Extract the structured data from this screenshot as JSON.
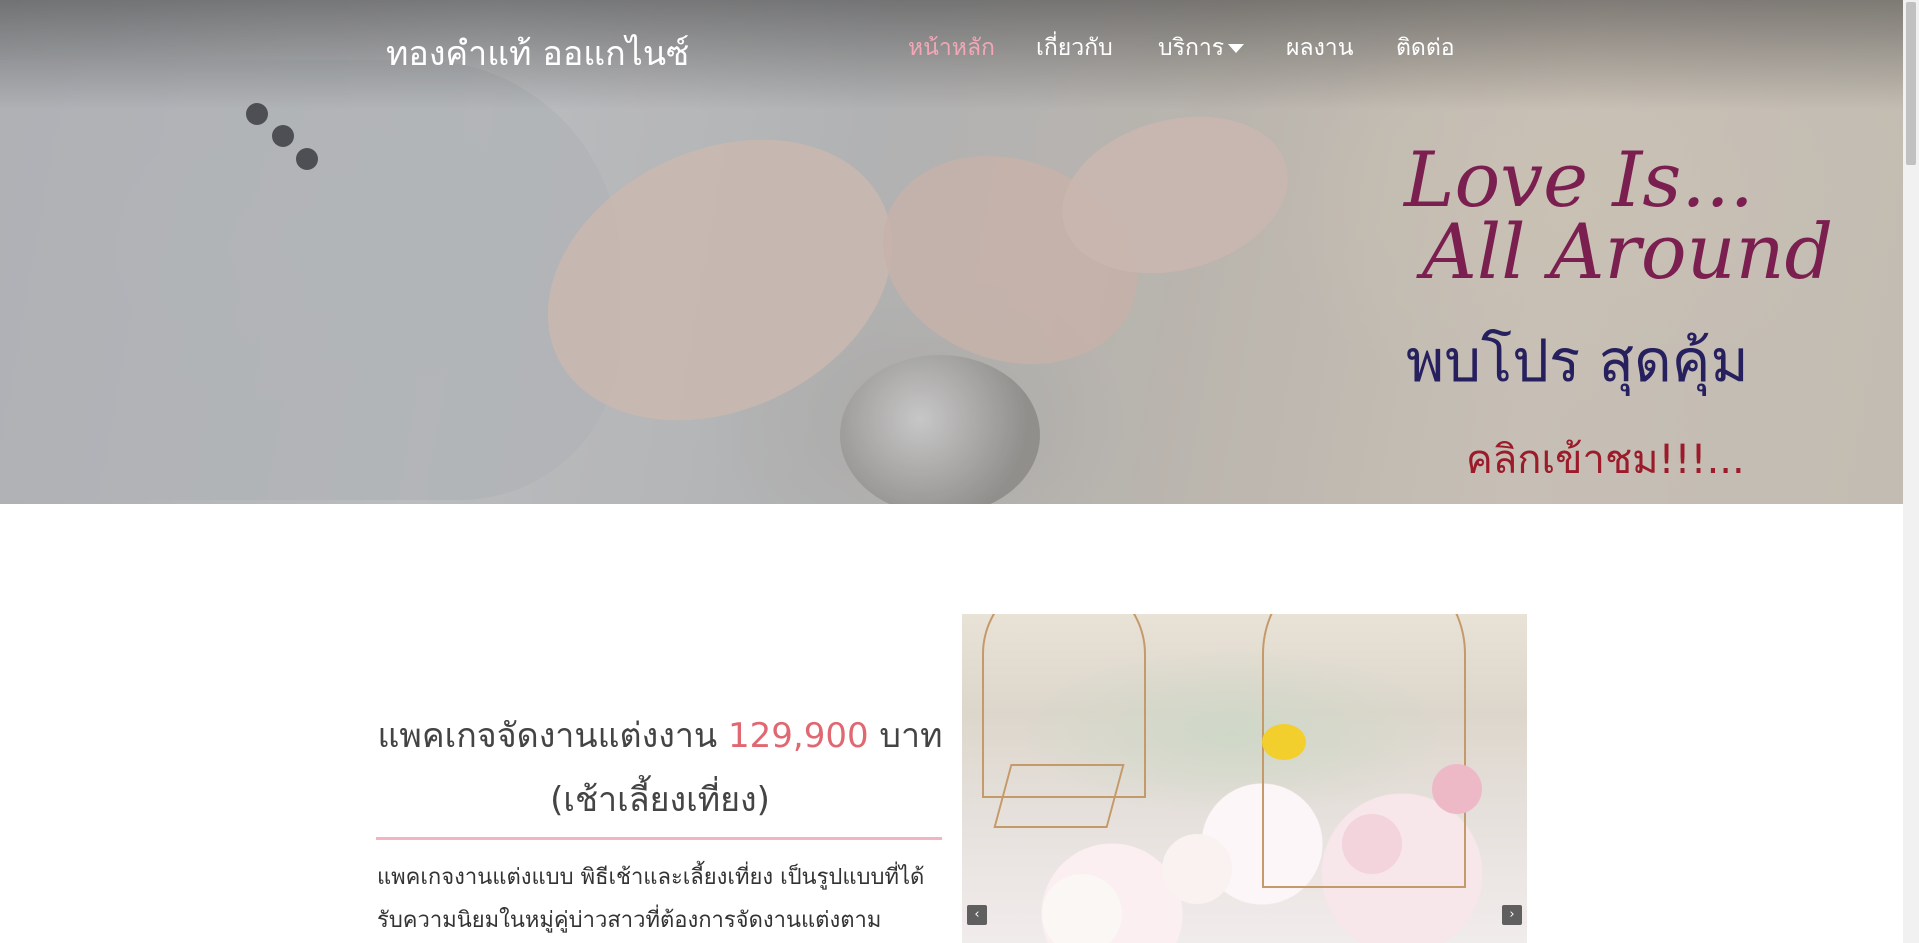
{
  "brand": "ทองคำแท้ ออแกไนซ์",
  "nav": {
    "items": [
      {
        "label": "หน้าหลัก",
        "active": true
      },
      {
        "label": "เกี่ยวกับ",
        "active": false
      },
      {
        "label": "บริการ",
        "active": false,
        "has_dropdown": true
      },
      {
        "label": "ผลงาน",
        "active": false
      },
      {
        "label": "ติดต่อ",
        "active": false
      }
    ]
  },
  "hero": {
    "line1": "Love Is...",
    "line2": "All Around",
    "line3": "พบโปร สุดคุ้ม",
    "line4": "คลิกเข้าชม!!!..."
  },
  "package": {
    "title_prefix": "แพคเกจจัดงานแต่งงาน",
    "price": "129,900",
    "currency": "บาท",
    "title_suffix": "(เช้าเลี้ยงเที่ยง)",
    "description": "แพคเกจงานแต่งแบบ พิธีเช้าและเลี้ยงเที่ยง เป็นรูปแบบที่ได้รับความนิยมในหมู่คู่บ่าวสาวที่ต้องการจัดงานแต่งตาม"
  },
  "carousel": {
    "prev": "‹",
    "next": "›"
  },
  "colors": {
    "accent": "#f3a7b6",
    "price": "#e06872",
    "divider": "#f4b3c0"
  }
}
